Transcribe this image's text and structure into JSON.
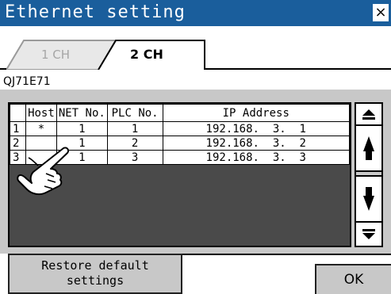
{
  "window": {
    "title": "Ethernet setting",
    "close_label": "×"
  },
  "tabs": [
    {
      "label": "1 CH",
      "active": false
    },
    {
      "label": "2 CH",
      "active": true
    }
  ],
  "module_name": "QJ71E71",
  "table": {
    "columns": [
      "",
      "Host",
      "NET No.",
      "PLC No.",
      "IP Address"
    ],
    "rows": [
      {
        "no": "1",
        "host": "*",
        "net": "1",
        "plc": "1",
        "ip": "192.168.  3.  1"
      },
      {
        "no": "2",
        "host": "",
        "net": "1",
        "plc": "2",
        "ip": "192.168.  3.  2"
      },
      {
        "no": "3",
        "host": "",
        "net": "1",
        "plc": "3",
        "ip": "192.168.  3.  3"
      }
    ]
  },
  "scroll": [
    "scroll-top-icon",
    "scroll-up-icon",
    "scroll-down-icon",
    "scroll-bottom-icon"
  ],
  "buttons": {
    "restore_line1": "Restore default",
    "restore_line2": "settings",
    "ok": "OK"
  },
  "colors": {
    "titlebar": "#1a5e9c",
    "panel": "#c8c8c8",
    "table_bg": "#4a4a4a"
  }
}
